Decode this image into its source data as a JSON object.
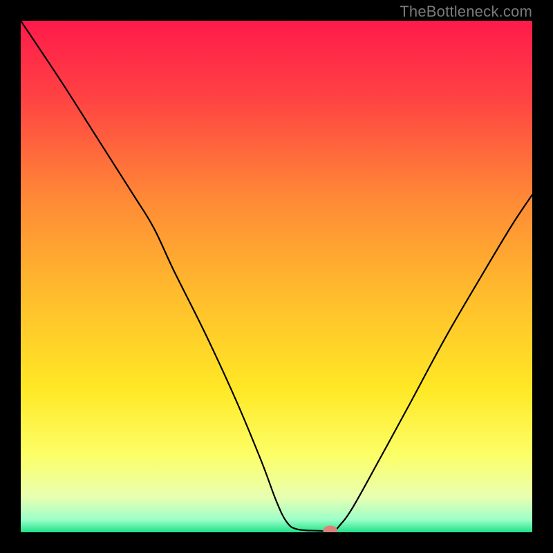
{
  "watermark": "TheBottleneck.com",
  "chart_data": {
    "type": "line",
    "title": "",
    "xlabel": "",
    "ylabel": "",
    "xlim": [
      0,
      100
    ],
    "ylim": [
      0,
      100
    ],
    "grid": false,
    "background": {
      "type": "vertical-gradient",
      "stops": [
        {
          "offset": 0.0,
          "color": "#ff1a4b"
        },
        {
          "offset": 0.15,
          "color": "#ff4243"
        },
        {
          "offset": 0.35,
          "color": "#ff8a36"
        },
        {
          "offset": 0.55,
          "color": "#ffc02c"
        },
        {
          "offset": 0.72,
          "color": "#ffe825"
        },
        {
          "offset": 0.85,
          "color": "#fcff68"
        },
        {
          "offset": 0.93,
          "color": "#e9ffb0"
        },
        {
          "offset": 0.975,
          "color": "#9effc9"
        },
        {
          "offset": 1.0,
          "color": "#1fe28a"
        }
      ]
    },
    "curve": {
      "stroke": "#000000",
      "stroke_width": 2.2,
      "points": [
        {
          "x": 0.0,
          "y": 100.0
        },
        {
          "x": 8.0,
          "y": 88.0
        },
        {
          "x": 15.0,
          "y": 77.0
        },
        {
          "x": 22.0,
          "y": 66.0
        },
        {
          "x": 26.0,
          "y": 59.5
        },
        {
          "x": 30.0,
          "y": 51.0
        },
        {
          "x": 36.0,
          "y": 39.0
        },
        {
          "x": 42.0,
          "y": 26.0
        },
        {
          "x": 47.0,
          "y": 14.0
        },
        {
          "x": 50.0,
          "y": 6.0
        },
        {
          "x": 52.0,
          "y": 2.0
        },
        {
          "x": 54.0,
          "y": 0.6
        },
        {
          "x": 58.0,
          "y": 0.3
        },
        {
          "x": 61.0,
          "y": 0.3
        },
        {
          "x": 62.5,
          "y": 1.5
        },
        {
          "x": 65.0,
          "y": 5.0
        },
        {
          "x": 70.0,
          "y": 14.0
        },
        {
          "x": 76.0,
          "y": 25.0
        },
        {
          "x": 83.0,
          "y": 38.0
        },
        {
          "x": 90.0,
          "y": 50.0
        },
        {
          "x": 96.0,
          "y": 60.0
        },
        {
          "x": 100.0,
          "y": 66.0
        }
      ]
    },
    "marker": {
      "x": 60.5,
      "y": 0.4,
      "rx": 1.4,
      "ry": 0.9,
      "fill": "#d9837a"
    }
  }
}
